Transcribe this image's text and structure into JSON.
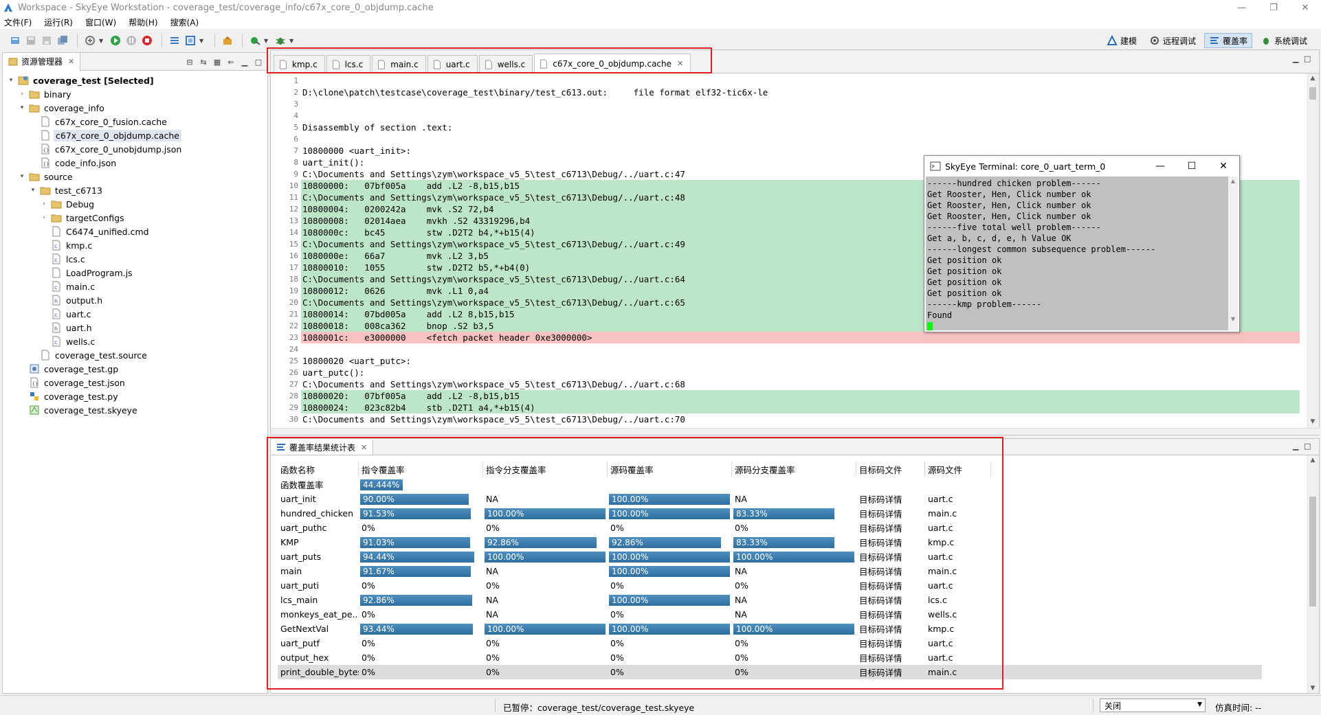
{
  "window": {
    "title": "Workspace - SkyEye Workstation - coverage_test/coverage_info/c67x_core_0_objdump.cache",
    "controls": [
      "—",
      "❐",
      "✕"
    ]
  },
  "menu": [
    "文件(F)",
    "运行(R)",
    "窗口(W)",
    "帮助(H)",
    "搜索(A)"
  ],
  "perspectives": [
    {
      "label": "建模",
      "icon": "model-icon",
      "active": false
    },
    {
      "label": "远程调试",
      "icon": "remote-debug-icon",
      "active": false
    },
    {
      "label": "覆盖率",
      "icon": "coverage-icon",
      "active": true
    },
    {
      "label": "系统调试",
      "icon": "system-debug-icon",
      "active": false
    }
  ],
  "explorer": {
    "tab_label": "资源管理器",
    "tree": [
      {
        "label": "coverage_test [Selected]",
        "depth": 0,
        "twisty": "▾",
        "icon": "project",
        "bold": true
      },
      {
        "label": "binary",
        "depth": 1,
        "twisty": "›",
        "icon": "folder"
      },
      {
        "label": "coverage_info",
        "depth": 1,
        "twisty": "▾",
        "icon": "folder"
      },
      {
        "label": "c67x_core_0_fusion.cache",
        "depth": 2,
        "twisty": "",
        "icon": "file"
      },
      {
        "label": "c67x_core_0_objdump.cache",
        "depth": 2,
        "twisty": "",
        "icon": "file",
        "selected": true
      },
      {
        "label": "c67x_core_0_unobjdump.json",
        "depth": 2,
        "twisty": "",
        "icon": "json"
      },
      {
        "label": "code_info.json",
        "depth": 2,
        "twisty": "",
        "icon": "json"
      },
      {
        "label": "source",
        "depth": 1,
        "twisty": "▾",
        "icon": "folder"
      },
      {
        "label": "test_c6713",
        "depth": 2,
        "twisty": "▾",
        "icon": "folder"
      },
      {
        "label": "Debug",
        "depth": 3,
        "twisty": "›",
        "icon": "folder"
      },
      {
        "label": "targetConfigs",
        "depth": 3,
        "twisty": "›",
        "icon": "folder"
      },
      {
        "label": "C6474_unified.cmd",
        "depth": 3,
        "twisty": "",
        "icon": "file"
      },
      {
        "label": "kmp.c",
        "depth": 3,
        "twisty": "",
        "icon": "c-file"
      },
      {
        "label": "lcs.c",
        "depth": 3,
        "twisty": "",
        "icon": "c-file"
      },
      {
        "label": "LoadProgram.js",
        "depth": 3,
        "twisty": "",
        "icon": "file"
      },
      {
        "label": "main.c",
        "depth": 3,
        "twisty": "",
        "icon": "c-file"
      },
      {
        "label": "output.h",
        "depth": 3,
        "twisty": "",
        "icon": "h-file"
      },
      {
        "label": "uart.c",
        "depth": 3,
        "twisty": "",
        "icon": "c-file"
      },
      {
        "label": "uart.h",
        "depth": 3,
        "twisty": "",
        "icon": "h-file"
      },
      {
        "label": "wells.c",
        "depth": 3,
        "twisty": "",
        "icon": "c-file"
      },
      {
        "label": "coverage_test.source",
        "depth": 2,
        "twisty": "",
        "icon": "file"
      },
      {
        "label": "coverage_test.gp",
        "depth": 1,
        "twisty": "",
        "icon": "gp"
      },
      {
        "label": "coverage_test.json",
        "depth": 1,
        "twisty": "",
        "icon": "json"
      },
      {
        "label": "coverage_test.py",
        "depth": 1,
        "twisty": "",
        "icon": "py"
      },
      {
        "label": "coverage_test.skyeye",
        "depth": 1,
        "twisty": "",
        "icon": "skyeye"
      }
    ]
  },
  "editor": {
    "tabs": [
      {
        "label": "kmp.c",
        "active": false,
        "closable": false
      },
      {
        "label": "lcs.c",
        "active": false,
        "closable": false
      },
      {
        "label": "main.c",
        "active": false,
        "closable": false
      },
      {
        "label": "uart.c",
        "active": false,
        "closable": false
      },
      {
        "label": "wells.c",
        "active": false,
        "closable": false
      },
      {
        "label": "c67x_core_0_objdump.cache",
        "active": true,
        "closable": true
      }
    ],
    "lines": [
      {
        "n": "1",
        "text": "",
        "hl": ""
      },
      {
        "n": "2",
        "text": "D:\\clone\\patch\\testcase\\coverage_test\\binary/test_c613.out:     file format elf32-tic6x-le",
        "hl": ""
      },
      {
        "n": "3",
        "text": "",
        "hl": ""
      },
      {
        "n": "4",
        "text": "",
        "hl": ""
      },
      {
        "n": "5",
        "text": "Disassembly of section .text:",
        "hl": ""
      },
      {
        "n": "6",
        "text": "",
        "hl": ""
      },
      {
        "n": "7",
        "text": "10800000 <uart_init>:",
        "hl": ""
      },
      {
        "n": "8",
        "text": "uart_init():",
        "hl": ""
      },
      {
        "n": "9",
        "text": "C:\\Documents and Settings\\zym\\workspace_v5_5\\test_c6713\\Debug/../uart.c:47",
        "hl": ""
      },
      {
        "n": "10",
        "text": "10800000:   07bf005a    add .L2 -8,b15,b15",
        "hl": "cov"
      },
      {
        "n": "11",
        "text": "C:\\Documents and Settings\\zym\\workspace_v5_5\\test_c6713\\Debug/../uart.c:48",
        "hl": "cov"
      },
      {
        "n": "12",
        "text": "10800004:   0200242a    mvk .S2 72,b4",
        "hl": "cov"
      },
      {
        "n": "13",
        "text": "10800008:   02014aea    mvkh .S2 43319296,b4",
        "hl": "cov"
      },
      {
        "n": "14",
        "text": "1080000c:   bc45        stw .D2T2 b4,*+b15(4)",
        "hl": "cov"
      },
      {
        "n": "15",
        "text": "C:\\Documents and Settings\\zym\\workspace_v5_5\\test_c6713\\Debug/../uart.c:49",
        "hl": "cov"
      },
      {
        "n": "16",
        "text": "1080000e:   66a7        mvk .L2 3,b5",
        "hl": "cov"
      },
      {
        "n": "17",
        "text": "10800010:   1055        stw .D2T2 b5,*+b4(0)",
        "hl": "cov"
      },
      {
        "n": "18",
        "text": "C:\\Documents and Settings\\zym\\workspace_v5_5\\test_c6713\\Debug/../uart.c:64",
        "hl": "cov"
      },
      {
        "n": "19",
        "text": "10800012:   0626        mvk .L1 0,a4",
        "hl": "cov"
      },
      {
        "n": "20",
        "text": "C:\\Documents and Settings\\zym\\workspace_v5_5\\test_c6713\\Debug/../uart.c:65",
        "hl": "cov"
      },
      {
        "n": "21",
        "text": "10800014:   07bd005a    add .L2 8,b15,b15",
        "hl": "cov"
      },
      {
        "n": "22",
        "text": "10800018:   008ca362    bnop .S2 b3,5",
        "hl": "cov"
      },
      {
        "n": "23",
        "text": "1080001c:   e3000000    <fetch packet header 0xe3000000>",
        "hl": "unc"
      },
      {
        "n": "24",
        "text": "",
        "hl": ""
      },
      {
        "n": "25",
        "text": "10800020 <uart_putc>:",
        "hl": ""
      },
      {
        "n": "26",
        "text": "uart_putc():",
        "hl": ""
      },
      {
        "n": "27",
        "text": "C:\\Documents and Settings\\zym\\workspace_v5_5\\test_c6713\\Debug/../uart.c:68",
        "hl": ""
      },
      {
        "n": "28",
        "text": "10800020:   07bf005a    add .L2 -8,b15,b15",
        "hl": "cov"
      },
      {
        "n": "29",
        "text": "10800024:   023c82b4    stb .D2T1 a4,*+b15(4)",
        "hl": "cov"
      },
      {
        "n": "30",
        "text": "C:\\Documents and Settings\\zym\\workspace_v5_5\\test_c6713\\Debug/../uart.c:70",
        "hl": ""
      }
    ]
  },
  "terminal": {
    "title": "SkyEye Terminal: core_0_uart_term_0",
    "lines": [
      "------hundred chicken problem------",
      "Get Rooster, Hen, Click number ok",
      "Get Rooster, Hen, Click number ok",
      "Get Rooster, Hen, Click number ok",
      "------five total well problem------",
      "Get a, b, c, d, e, h Value OK",
      "------longest common subsequence problem------",
      "Get position ok",
      "Get position ok",
      "Get position ok",
      "Get position ok",
      "------kmp problem------",
      "Found"
    ]
  },
  "coverage": {
    "tab_label": "覆盖率结果统计表",
    "headers": [
      "函数名称",
      "指令覆盖率",
      "指令分支覆盖率",
      "源码覆盖率",
      "源码分支覆盖率",
      "目标码文件",
      "源码文件"
    ],
    "summary": {
      "label": "函数覆盖率",
      "value": "44.444%",
      "pct": 44.444
    },
    "rows": [
      {
        "name": "uart_init",
        "c1": "90.00%",
        "p1": 90.0,
        "c2": "NA",
        "p2": null,
        "c3": "100.00%",
        "p3": 100,
        "c4": "NA",
        "p4": null,
        "obj": "目标码详情",
        "src": "uart.c"
      },
      {
        "name": "hundred_chicken",
        "c1": "91.53%",
        "p1": 91.53,
        "c2": "100.00%",
        "p2": 100,
        "c3": "100.00%",
        "p3": 100,
        "c4": "83.33%",
        "p4": 83.33,
        "obj": "目标码详情",
        "src": "main.c"
      },
      {
        "name": "uart_puthc",
        "c1": "0%",
        "p1": 0,
        "c2": "0%",
        "p2": 0,
        "c3": "0%",
        "p3": 0,
        "c4": "0%",
        "p4": 0,
        "obj": "目标码详情",
        "src": "uart.c"
      },
      {
        "name": "KMP",
        "c1": "91.03%",
        "p1": 91.03,
        "c2": "92.86%",
        "p2": 92.86,
        "c3": "92.86%",
        "p3": 92.86,
        "c4": "83.33%",
        "p4": 83.33,
        "obj": "目标码详情",
        "src": "kmp.c"
      },
      {
        "name": "uart_puts",
        "c1": "94.44%",
        "p1": 94.44,
        "c2": "100.00%",
        "p2": 100,
        "c3": "100.00%",
        "p3": 100,
        "c4": "100.00%",
        "p4": 100,
        "obj": "目标码详情",
        "src": "uart.c"
      },
      {
        "name": "main",
        "c1": "91.67%",
        "p1": 91.67,
        "c2": "NA",
        "p2": null,
        "c3": "100.00%",
        "p3": 100,
        "c4": "NA",
        "p4": null,
        "obj": "目标码详情",
        "src": "main.c"
      },
      {
        "name": "uart_puti",
        "c1": "0%",
        "p1": 0,
        "c2": "0%",
        "p2": 0,
        "c3": "0%",
        "p3": 0,
        "c4": "0%",
        "p4": 0,
        "obj": "目标码详情",
        "src": "uart.c"
      },
      {
        "name": "lcs_main",
        "c1": "92.86%",
        "p1": 92.86,
        "c2": "NA",
        "p2": null,
        "c3": "100.00%",
        "p3": 100,
        "c4": "NA",
        "p4": null,
        "obj": "目标码详情",
        "src": "lcs.c"
      },
      {
        "name": "monkeys_eat_pe...",
        "c1": "0%",
        "p1": 0,
        "c2": "NA",
        "p2": null,
        "c3": "0%",
        "p3": 0,
        "c4": "NA",
        "p4": null,
        "obj": "目标码详情",
        "src": "wells.c"
      },
      {
        "name": "GetNextVal",
        "c1": "93.44%",
        "p1": 93.44,
        "c2": "100.00%",
        "p2": 100,
        "c3": "100.00%",
        "p3": 100,
        "c4": "100.00%",
        "p4": 100,
        "obj": "目标码详情",
        "src": "kmp.c"
      },
      {
        "name": "uart_putf",
        "c1": "0%",
        "p1": 0,
        "c2": "0%",
        "p2": 0,
        "c3": "0%",
        "p3": 0,
        "c4": "0%",
        "p4": 0,
        "obj": "目标码详情",
        "src": "uart.c"
      },
      {
        "name": "output_hex",
        "c1": "0%",
        "p1": 0,
        "c2": "0%",
        "p2": 0,
        "c3": "0%",
        "p3": 0,
        "c4": "0%",
        "p4": 0,
        "obj": "目标码详情",
        "src": "uart.c"
      },
      {
        "name": "print_double_bytes",
        "c1": "0%",
        "p1": 0,
        "c2": "0%",
        "p2": 0,
        "c3": "0%",
        "p3": 0,
        "c4": "0%",
        "p4": 0,
        "obj": "目标码详情",
        "src": "main.c",
        "selected": true
      }
    ]
  },
  "status": {
    "message": "已暂停：coverage_test/coverage_test.skyeye",
    "select_value": "关闭",
    "sim_time_label": "仿真时间: --"
  },
  "colors": {
    "covered": "#bde5c8",
    "uncovered": "#f9c2c2",
    "bar": "#3a7cae",
    "highlight_box": "#e02020"
  }
}
